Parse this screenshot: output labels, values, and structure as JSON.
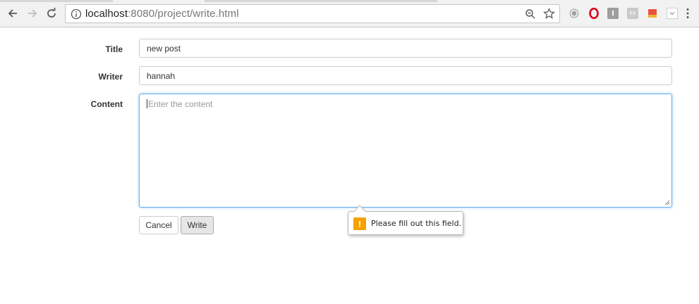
{
  "browser": {
    "url_host": "localhost",
    "url_rest": ":8080/project/write.html",
    "extensions": [
      {
        "name": "record-icon",
        "color": "#9e9e9e"
      },
      {
        "name": "opera-icon",
        "color": "#e0001a"
      },
      {
        "name": "ext-i-icon",
        "color": "#9e9e9e",
        "text": "I"
      },
      {
        "name": "ext-ex-icon",
        "color": "#bdbdbd",
        "text": "EX"
      },
      {
        "name": "ext-book-icon",
        "color": "#e8513d"
      },
      {
        "name": "ext-dropdown-icon",
        "color": "#e0e0e0"
      }
    ]
  },
  "form": {
    "title_label": "Title",
    "title_value": "new post",
    "writer_label": "Writer",
    "writer_value": "hannah",
    "content_label": "Content",
    "content_placeholder": "Enter the content",
    "cancel_label": "Cancel",
    "write_label": "Write"
  },
  "validation": {
    "icon": "!",
    "message": "Please fill out this field.",
    "color": "#f6a100"
  },
  "colors": {
    "focus_border": "#66afe9"
  }
}
